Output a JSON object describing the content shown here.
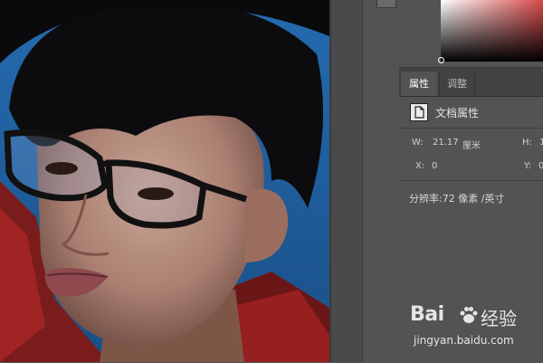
{
  "properties_panel": {
    "tabs": [
      {
        "label": "属性",
        "active": true
      },
      {
        "label": "调整",
        "active": false
      }
    ],
    "section_title": "文档属性",
    "width_label": "W:",
    "width_value": "21.17",
    "width_unit": "厘米",
    "height_label": "H:",
    "height_value": "1",
    "x_label": "X:",
    "x_value": "0",
    "y_label": "Y:",
    "y_value": "0",
    "resolution_label": "分辨率:",
    "resolution_value": "72 像素 /英寸"
  },
  "watermark": {
    "logo_text": "Bai",
    "logo_text_suffix": "经验",
    "url": "jingyan.baidu.com"
  },
  "colors": {
    "panel_bg": "#535353",
    "tab_bar_bg": "#424242",
    "active_tab_text": "#ffffff",
    "canvas_bg": "#2b6fad"
  },
  "icons": [
    "document-icon",
    "baidu-paw-icon"
  ]
}
